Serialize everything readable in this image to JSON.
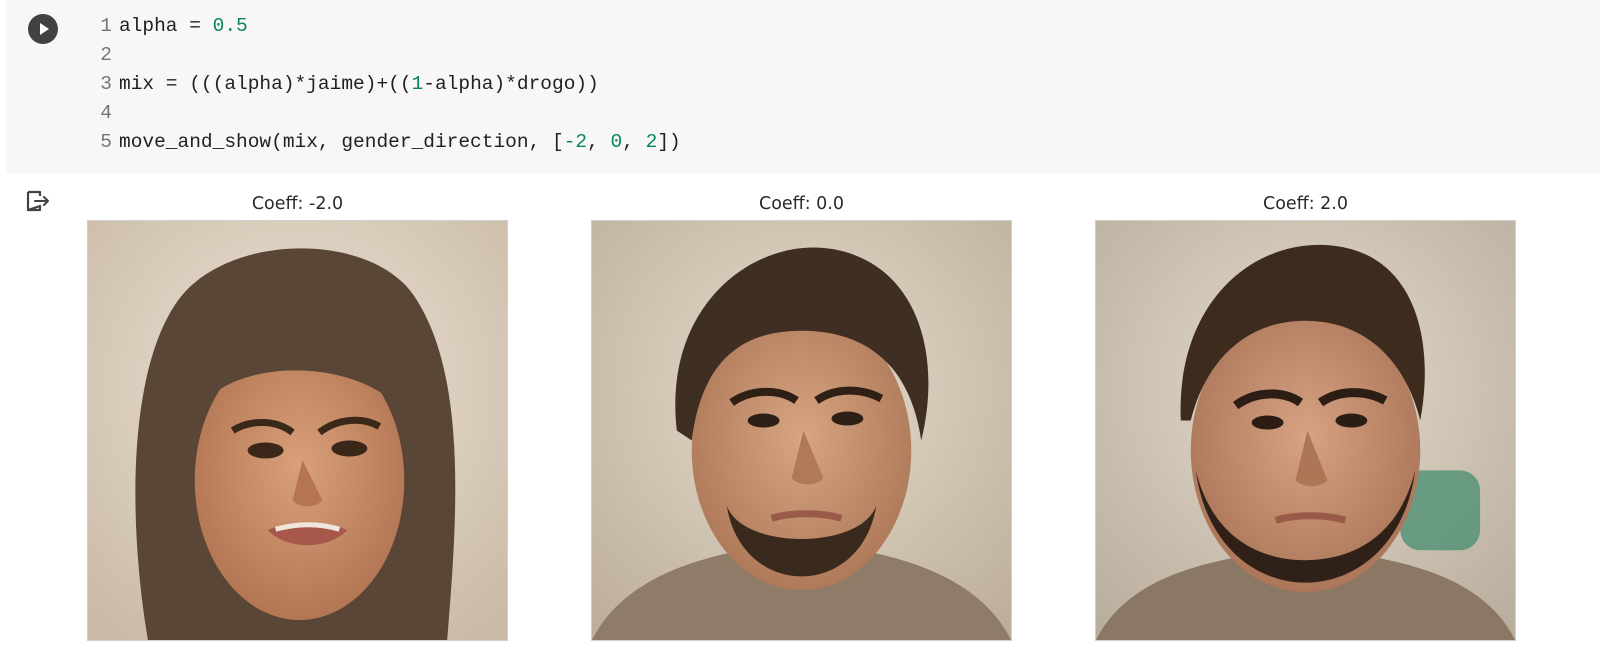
{
  "code_cell": {
    "lines": [
      {
        "number": "1",
        "tokens": [
          {
            "text": "alpha = ",
            "type": "default"
          },
          {
            "text": "0.5",
            "type": "num"
          }
        ]
      },
      {
        "number": "2",
        "tokens": []
      },
      {
        "number": "3",
        "tokens": [
          {
            "text": "mix = (((alpha)*jaime)+((",
            "type": "default"
          },
          {
            "text": "1",
            "type": "num"
          },
          {
            "text": "-alpha)*drogo))",
            "type": "default"
          }
        ]
      },
      {
        "number": "4",
        "tokens": []
      },
      {
        "number": "5",
        "tokens": [
          {
            "text": "move_and_show(mix, gender_direction, [",
            "type": "default"
          },
          {
            "text": "-2",
            "type": "num"
          },
          {
            "text": ", ",
            "type": "default"
          },
          {
            "text": "0",
            "type": "num"
          },
          {
            "text": ", ",
            "type": "default"
          },
          {
            "text": "2",
            "type": "num"
          },
          {
            "text": "])",
            "type": "default"
          }
        ]
      }
    ]
  },
  "icons": {
    "run": "play-circle-icon",
    "output": "output-redirect-icon"
  },
  "output": {
    "panels": [
      {
        "title": "Coeff: -2.0",
        "image": "face-feminine"
      },
      {
        "title": "Coeff: 0.0",
        "image": "face-neutral"
      },
      {
        "title": "Coeff: 2.0",
        "image": "face-masculine"
      }
    ]
  },
  "colors": {
    "code_background": "#f7f7f7",
    "number_literal": "#098658",
    "run_button": "#424242"
  }
}
